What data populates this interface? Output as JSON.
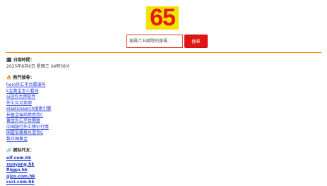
{
  "header": {
    "logo_text": "65",
    "colors": {
      "logo_bg": "#f4e300",
      "logo_text": "#e61a10",
      "accent": "#ff8800",
      "link": "#1a35d8",
      "button": "#e11515"
    }
  },
  "search": {
    "placeholder": "搜尋六五國際的搜尋...",
    "button_label": "搜尋"
  },
  "date_section": {
    "heading": "🗓 日期時間：",
    "value": "2025年8月6日 星期三 04時58分"
  },
  "hot_section": {
    "heading": "🔥 熱門搜尋：",
    "links": [
      "hero外汇平台靠谱吗",
      "k金黄金怎么看纯",
      "ai创作大师软件",
      "外汇买对卖哪",
      "elasticsearch搜索引擎",
      "长盈金瑞纯债债券C",
      "黄金外汇平台開盘",
      "中国银行外汇牌价行情",
      "国富伯雅推兑混合C",
      "数正国黄金"
    ]
  },
  "friend_section": {
    "heading": "🔗 網站托友：",
    "links": [
      "eif.com.hk",
      "xunyang.hk",
      "fliggu.hk",
      "qizo.com.hk",
      "csci.com.hk"
    ]
  }
}
